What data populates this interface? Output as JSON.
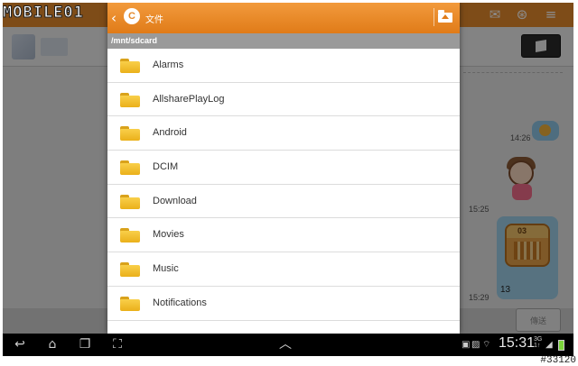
{
  "watermark": {
    "brand": "MOBILE01",
    "id": "#33120"
  },
  "background_app": {
    "times": [
      "14:26",
      "15:25",
      "15:29"
    ],
    "calendar_day": "03",
    "calendar_value": "13",
    "send_label": "傳送"
  },
  "dialog": {
    "title": "文件",
    "path": "/mnt/sdcard",
    "folders": [
      "Alarms",
      "AllsharePlayLog",
      "Android",
      "DCIM",
      "Download",
      "Movies",
      "Music",
      "Notifications"
    ]
  },
  "status_bar": {
    "clock": "15:31",
    "network": "3G",
    "network_sub": "1↑"
  },
  "colors": {
    "accent": "#e58a2c",
    "folder": "#f3bf2a"
  }
}
